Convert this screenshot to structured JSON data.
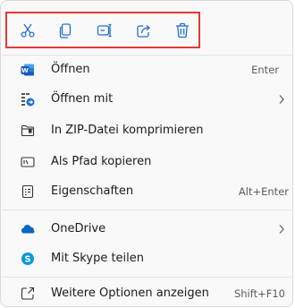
{
  "quick_actions": [
    {
      "name": "cut",
      "icon": "scissors-icon"
    },
    {
      "name": "copy",
      "icon": "copy-icon"
    },
    {
      "name": "rename",
      "icon": "rename-icon"
    },
    {
      "name": "share",
      "icon": "share-icon"
    },
    {
      "name": "delete",
      "icon": "trash-icon"
    }
  ],
  "menu": {
    "open": {
      "label": "Öffnen",
      "shortcut": "Enter",
      "icon": "word-icon"
    },
    "open_with": {
      "label": "Öffnen mit",
      "icon": "open-with-icon"
    },
    "zip": {
      "label": "In ZIP-Datei komprimieren",
      "icon": "zip-folder-icon"
    },
    "copy_path": {
      "label": "Als Pfad kopieren",
      "icon": "path-icon"
    },
    "properties": {
      "label": "Eigenschaften",
      "shortcut": "Alt+Enter",
      "icon": "properties-icon"
    },
    "onedrive": {
      "label": "OneDrive",
      "icon": "onedrive-cloud-icon"
    },
    "skype": {
      "label": "Mit Skype teilen",
      "icon": "skype-icon"
    },
    "more": {
      "label": "Weitere Optionen anzeigen",
      "shortcut": "Shift+F10",
      "icon": "more-options-icon"
    }
  },
  "colors": {
    "accent": "#1f6fd0",
    "highlight_border": "#e53935",
    "word_blue": "#185abd",
    "onedrive_blue": "#0a64c2",
    "skype_blue": "#0896e4"
  }
}
